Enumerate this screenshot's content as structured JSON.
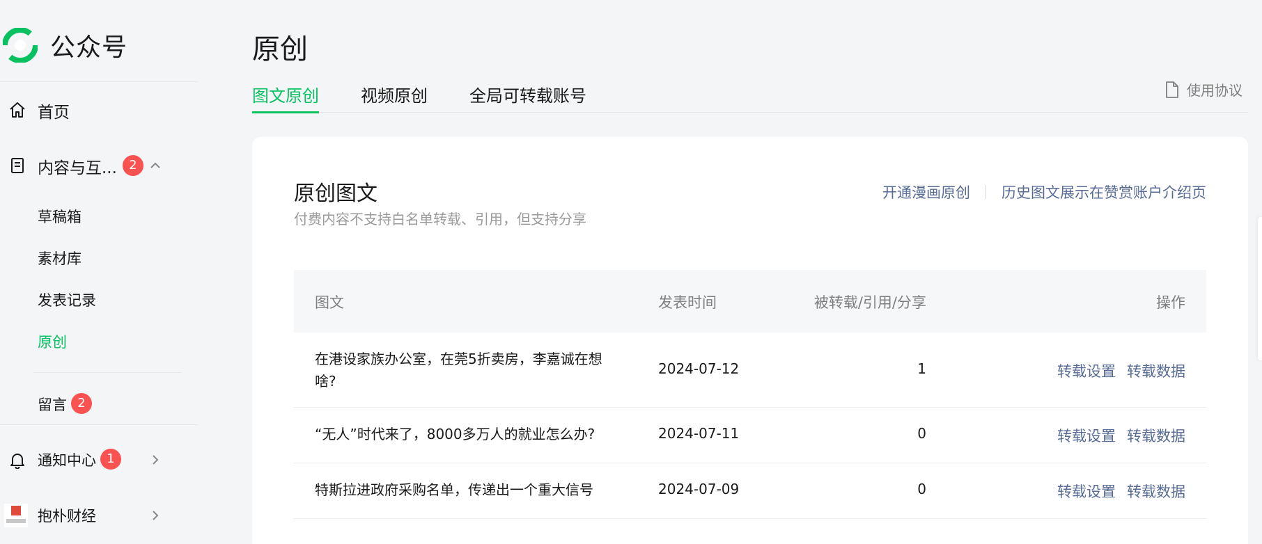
{
  "colors": {
    "accent": "#07c160",
    "link": "#576b95",
    "badge": "#fa5151"
  },
  "sidebar": {
    "app_name": "公众号",
    "home": {
      "label": "首页",
      "icon": "home-icon"
    },
    "content": {
      "label": "内容与互...",
      "badge": "2",
      "icon": "document-icon"
    },
    "sub_items": [
      {
        "label": "草稿箱"
      },
      {
        "label": "素材库"
      },
      {
        "label": "发表记录"
      },
      {
        "label": "原创"
      }
    ],
    "comments": {
      "label": "留言",
      "badge": "2"
    },
    "notifications": {
      "label": "通知中心",
      "badge": "1",
      "icon": "bell-icon"
    },
    "account": {
      "label": "抱朴财经",
      "icon": "account-avatar"
    }
  },
  "main": {
    "page_title": "原创",
    "tabs": [
      {
        "label": "图文原创",
        "active": true
      },
      {
        "label": "视频原创",
        "active": false
      },
      {
        "label": "全局可转载账号",
        "active": false
      }
    ],
    "agreement_label": "使用协议",
    "card": {
      "title": "原创图文",
      "subtitle": "付费内容不支持白名单转载、引用，但支持分享",
      "links": [
        "开通漫画原创",
        "历史图文展示在赞赏账户介绍页"
      ]
    },
    "table": {
      "headers": [
        "图文",
        "发表时间",
        "被转载/引用/分享",
        "操作"
      ],
      "rows": [
        {
          "title": "在港设家族办公室，在莞5折卖房，李嘉诚在想啥?",
          "date": "2024-07-12",
          "count": "1",
          "op1": "转载设置",
          "op2": "转载数据"
        },
        {
          "title": "“无人”时代来了，8000多万人的就业怎么办?",
          "date": "2024-07-11",
          "count": "0",
          "op1": "转载设置",
          "op2": "转载数据"
        },
        {
          "title": "特斯拉进政府采购名单，传递出一个重大信号",
          "date": "2024-07-09",
          "count": "0",
          "op1": "转载设置",
          "op2": "转载数据"
        }
      ]
    }
  }
}
